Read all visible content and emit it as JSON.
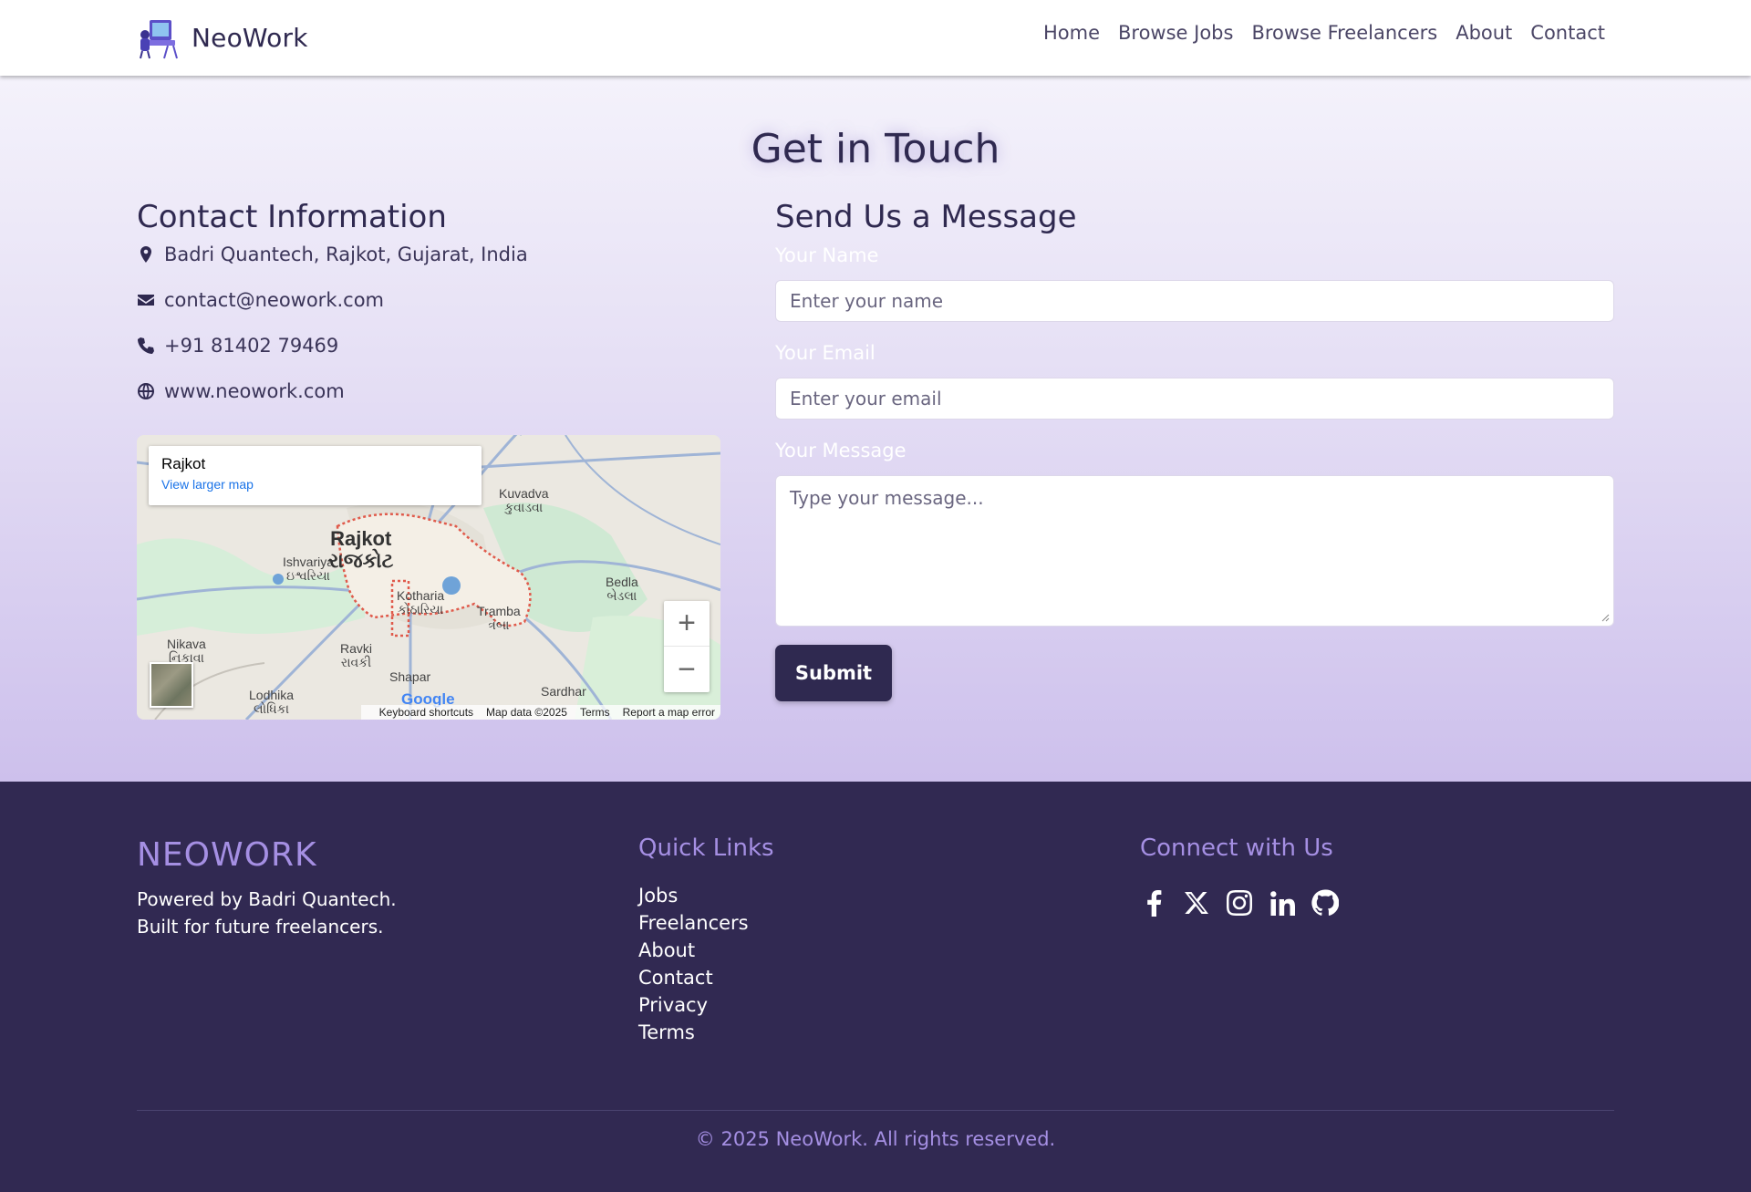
{
  "navbar": {
    "brand": "NeoWork",
    "links": [
      "Home",
      "Browse Jobs",
      "Browse Freelancers",
      "About",
      "Contact"
    ]
  },
  "page": {
    "title": "Get in Touch"
  },
  "contact_info": {
    "heading": "Contact Information",
    "address": "Badri Quantech, Rajkot, Gujarat, India",
    "email": "contact@neowork.com",
    "phone": "+91 81402 79469",
    "website": "www.neowork.com"
  },
  "map": {
    "place": "Rajkot",
    "view_larger": "View larger map",
    "labels": {
      "rajkot": "Rajkot",
      "rajkot_gu": "રાજકોટ",
      "kuvadva": "Kuvadva",
      "kuvadva_gu": "કુવાડવા",
      "ishvariya": "Ishvariya",
      "ishvariya_gu": "ઇશ્વરિયા",
      "kotharia": "Kotharia",
      "kotharia_gu": "કોઠારિયા",
      "tramba": "Tramba",
      "tramba_gu": "ત્રંબા",
      "bedla": "Bedla",
      "bedla_gu": "બેડલા",
      "nikava": "Nikava",
      "nikava_gu": "નિકાવા",
      "ravki": "Ravki",
      "ravki_gu": "રાવકી",
      "shapar": "Shapar",
      "lodhika": "Lodhika",
      "lodhika_gu": "લોધિકા",
      "sardhar": "Sardhar"
    },
    "zoom_in": "+",
    "zoom_out": "−",
    "google": "Google",
    "footer": [
      "Keyboard shortcuts",
      "Map data ©2025",
      "Terms",
      "Report a map error"
    ]
  },
  "form": {
    "heading": "Send Us a Message",
    "name_label": "Your Name",
    "name_placeholder": "Enter your name",
    "email_label": "Your Email",
    "email_placeholder": "Enter your email",
    "message_label": "Your Message",
    "message_placeholder": "Type your message...",
    "submit": "Submit"
  },
  "footer": {
    "brand": "NEOWORK",
    "tagline_1": "Powered by Badri Quantech.",
    "tagline_2": "Built for future freelancers.",
    "quick_links_heading": "Quick Links",
    "quick_links": [
      "Jobs",
      "Freelancers",
      "About",
      "Contact",
      "Privacy",
      "Terms"
    ],
    "connect_heading": "Connect with Us",
    "socials": [
      "facebook-icon",
      "x-twitter-icon",
      "instagram-icon",
      "linkedin-icon",
      "github-icon"
    ],
    "copyright": "© 2025 NeoWork. All rights reserved."
  },
  "colors": {
    "primary": "#2f2950",
    "accent": "#a58fe3",
    "footer_bg": "#312952",
    "link_blue": "#1a73e8"
  }
}
